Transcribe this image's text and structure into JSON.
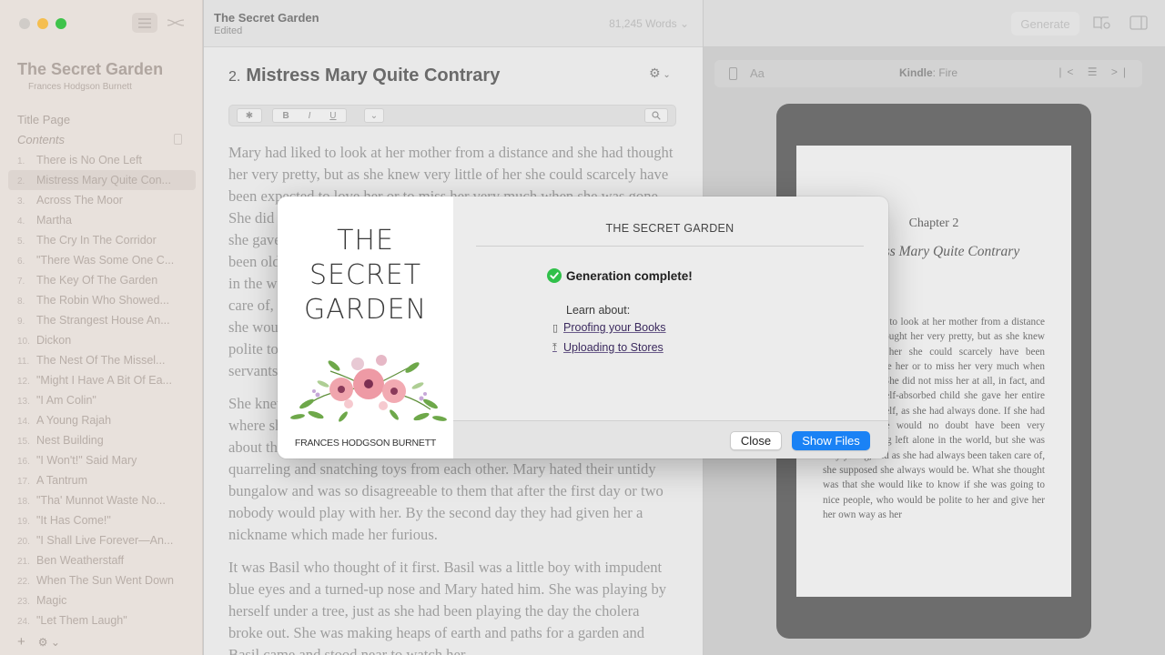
{
  "sidebar": {
    "book_title": "The Secret Garden",
    "book_author": "Frances Hodgson Burnett",
    "title_page_label": "Title Page",
    "contents_label": "Contents",
    "chapters": [
      {
        "num": "1.",
        "label": "There is No One Left"
      },
      {
        "num": "2.",
        "label": "Mistress Mary Quite Con..."
      },
      {
        "num": "3.",
        "label": "Across The Moor"
      },
      {
        "num": "4.",
        "label": "Martha"
      },
      {
        "num": "5.",
        "label": "The Cry In The Corridor"
      },
      {
        "num": "6.",
        "label": "\"There Was Some One C..."
      },
      {
        "num": "7.",
        "label": "The Key Of The Garden"
      },
      {
        "num": "8.",
        "label": "The Robin Who Showed..."
      },
      {
        "num": "9.",
        "label": "The Strangest House An..."
      },
      {
        "num": "10.",
        "label": "Dickon"
      },
      {
        "num": "11.",
        "label": "The Nest Of The Missel..."
      },
      {
        "num": "12.",
        "label": "\"Might I Have A Bit Of Ea..."
      },
      {
        "num": "13.",
        "label": "\"I Am Colin\""
      },
      {
        "num": "14.",
        "label": "A Young Rajah"
      },
      {
        "num": "15.",
        "label": "Nest Building"
      },
      {
        "num": "16.",
        "label": "\"I Won't!\" Said Mary"
      },
      {
        "num": "17.",
        "label": "A Tantrum"
      },
      {
        "num": "18.",
        "label": "\"Tha' Munnot Waste No..."
      },
      {
        "num": "19.",
        "label": "\"It Has Come!\""
      },
      {
        "num": "20.",
        "label": "\"I Shall Live Forever—An..."
      },
      {
        "num": "21.",
        "label": "Ben Weatherstaff"
      },
      {
        "num": "22.",
        "label": "When The Sun Went Down"
      },
      {
        "num": "23.",
        "label": "Magic"
      },
      {
        "num": "24.",
        "label": "\"Let Them Laugh\""
      }
    ],
    "add_label": "+",
    "gear_label": "⚙ ⌄"
  },
  "editor": {
    "doc_title": "The Secret Garden",
    "doc_status": "Edited",
    "word_count": "81,245 Words",
    "chapter_number": "2.",
    "chapter_title": "Mistress Mary Quite Contrary",
    "format": {
      "style": "✱",
      "bold": "B",
      "italic": "I",
      "underline": "U"
    },
    "paragraphs": [
      "Mary had liked to look at her mother from a distance and she had thought her very pretty, but as she knew very little of her she could scarcely have been expected to love her or to miss her very much when she was gone. She did not miss her at all, in fact, and as she was a self-absorbed child she gave her entire thought to herself, as she had always done. If she had been older she would no doubt have been very anxious at being left alone in the world, but she was very young, and as she had always been taken care of, she supposed she always would be. What she thought was that she would like to know if she was going to nice people, who would be polite to her and give her her own way as her Ayah and the other native servants had done.",
      "She knew that she was not going to stay at the English clergyman's house where she was taken at first. The English clergyman's children were of about the same age and they wore shabby clothes and were always quarreling and snatching toys from each other. Mary hated their untidy bungalow and was so disagreeable to them that after the first day or two nobody would play with her. By the second day they had given her a nickname which made her furious.",
      "It was Basil who thought of it first. Basil was a little boy with impudent blue eyes and a turned-up nose and Mary hated him. She was playing by herself under a tree, just as she had been playing the day the cholera broke out. She was making heaps of earth and paths for a garden and Basil came and stood near to watch her."
    ]
  },
  "preview": {
    "generate_label": "Generate",
    "aa_label": "Aa",
    "device_prefix": "Kindle",
    "device_name": ": Fire",
    "nav_label": "|< ☰ >|",
    "screen_chapter": "Chapter 2",
    "screen_title": "Mistress Mary Quite Contrary",
    "screen_body": "Mary had liked to look at her mother from a distance and she had thought her very pretty, but as she knew very little of her she could scarcely have been expected to love her or to miss her very much when she was gone. She did not miss her at all, in fact, and as she was a self-absorbed child she gave her entire thought to herself, as she had always done. If she had been older she would no doubt have been very anxious at being left alone in the world, but she was very young, and as she had always been taken care of, she supposed she always would be. What she thought was that she would like to know if she was going to nice people, who would be polite to her and give her her own way as her"
  },
  "modal": {
    "cover": {
      "title_line1": "THE",
      "title_line2": "SECRET",
      "title_line3": "GARDEN",
      "author": "FRANCES HODGSON BURNETT"
    },
    "book_title": "THE SECRET GARDEN",
    "status": "Generation complete!",
    "learn_about": "Learn about:",
    "links": [
      {
        "icon": "phone-icon",
        "glyph": "▯",
        "label": "Proofing your Books"
      },
      {
        "icon": "upload-icon",
        "glyph": "⤒",
        "label": "Uploading to Stores"
      }
    ],
    "close_label": "Close",
    "show_files_label": "Show Files",
    "colors": {
      "accent": "#1a82f5",
      "success": "#30c04a"
    }
  }
}
